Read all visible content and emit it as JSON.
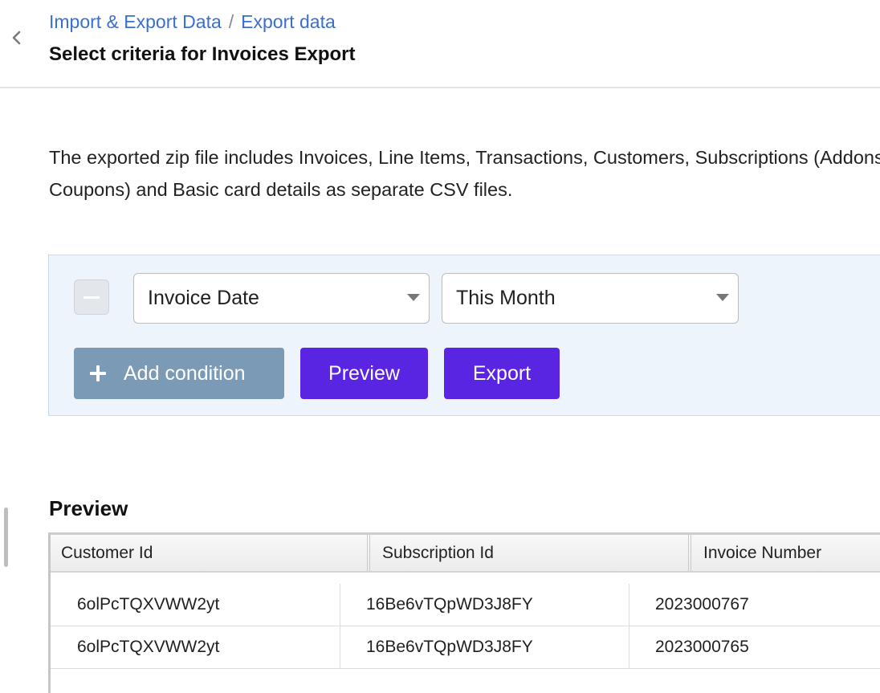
{
  "breadcrumb": {
    "parent": "Import & Export Data",
    "separator": "/",
    "current": "Export data"
  },
  "page_title": "Select criteria for Invoices Export",
  "description": "The exported zip file includes Invoices, Line Items, Transactions, Customers, Subscriptions (Addons, Coupons) and Basic card details as separate CSV files.",
  "criteria": {
    "field_select": "Invoice Date",
    "range_select": "This Month",
    "add_condition_label": "Add condition",
    "preview_label": "Preview",
    "export_label": "Export"
  },
  "preview": {
    "heading": "Preview",
    "columns": [
      "Customer Id",
      "Subscription Id",
      "Invoice Number"
    ],
    "rows": [
      [
        "6olPcTQXVWW2yt",
        "16Be6vTQpWD3J8FY",
        "2023000767"
      ],
      [
        "6olPcTQXVWW2yt",
        "16Be6vTQpWD3J8FY",
        "2023000765"
      ]
    ]
  },
  "icons": {
    "back": "chevron-left-icon",
    "remove": "minus-icon",
    "add": "plus-icon",
    "dropdown": "caret-down-icon"
  },
  "colors": {
    "link": "#3a6fd1",
    "primary_button": "#5a25e2",
    "secondary_button": "#7a9ab5",
    "panel_background": "#eef4fc"
  }
}
